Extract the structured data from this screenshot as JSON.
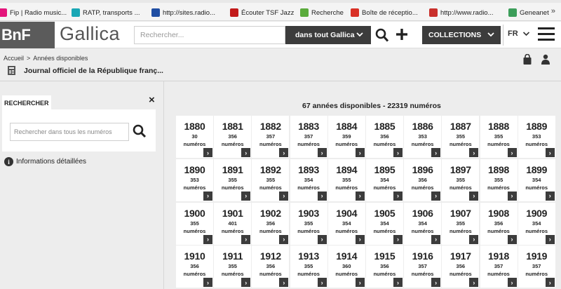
{
  "bookmarks": [
    {
      "label": "Fip | Radio music...",
      "icon": "fip-icon",
      "color": "#e4157c"
    },
    {
      "label": "RATP, transports ...",
      "icon": "ratp-icon",
      "color": "#1aa7b5"
    },
    {
      "label": "http://sites.radio...",
      "icon": "radiofrance-icon",
      "color": "#1f4ea3"
    },
    {
      "label": "Écouter TSF Jazz",
      "icon": "tsf-icon",
      "color": "#c21a1a"
    },
    {
      "label": "Recherche",
      "icon": "recherche-icon",
      "color": "#5aab3c"
    },
    {
      "label": "Boîte de réceptio...",
      "icon": "gmail-icon",
      "color": "#d93025"
    },
    {
      "label": "http://www.radio...",
      "icon": "radio-icon",
      "color": "#c9302c"
    },
    {
      "label": "Geneanet",
      "icon": "geneanet-icon",
      "color": "#3c9e5a"
    }
  ],
  "bookmarks_more": "»",
  "header": {
    "logo_bnf": "BnF",
    "logo_gallica": "Gallica",
    "search_placeholder": "Rechercher...",
    "scope": "dans tout Gallica",
    "collections": "COLLECTIONS",
    "lang": "FR"
  },
  "breadcrumb": {
    "home": "Accueil",
    "sep": ">",
    "current": "Années disponibles"
  },
  "doc_title": "Journal officiel de la République franç...",
  "left": {
    "tab": "RECHERCHER",
    "close": "×",
    "search_placeholder": "Rechercher dans tous les numéros",
    "info": "Informations détaillées"
  },
  "summary": "67 années disponibles - 22319 numéros",
  "unit_label": "numéros",
  "go_label": "›",
  "years": [
    {
      "year": "1880",
      "count": "30"
    },
    {
      "year": "1881",
      "count": "356"
    },
    {
      "year": "1882",
      "count": "357"
    },
    {
      "year": "1883",
      "count": "357"
    },
    {
      "year": "1884",
      "count": "359"
    },
    {
      "year": "1885",
      "count": "356"
    },
    {
      "year": "1886",
      "count": "353"
    },
    {
      "year": "1887",
      "count": "355"
    },
    {
      "year": "1888",
      "count": "355"
    },
    {
      "year": "1889",
      "count": "353"
    },
    {
      "year": "1890",
      "count": "353"
    },
    {
      "year": "1891",
      "count": "355"
    },
    {
      "year": "1892",
      "count": "355"
    },
    {
      "year": "1893",
      "count": "354"
    },
    {
      "year": "1894",
      "count": "355"
    },
    {
      "year": "1895",
      "count": "354"
    },
    {
      "year": "1896",
      "count": "356"
    },
    {
      "year": "1897",
      "count": "355"
    },
    {
      "year": "1898",
      "count": "355"
    },
    {
      "year": "1899",
      "count": "354"
    },
    {
      "year": "1900",
      "count": "355"
    },
    {
      "year": "1901",
      "count": "401"
    },
    {
      "year": "1902",
      "count": "356"
    },
    {
      "year": "1903",
      "count": "355"
    },
    {
      "year": "1904",
      "count": "354"
    },
    {
      "year": "1905",
      "count": "354"
    },
    {
      "year": "1906",
      "count": "354"
    },
    {
      "year": "1907",
      "count": "355"
    },
    {
      "year": "1908",
      "count": "356"
    },
    {
      "year": "1909",
      "count": "354"
    },
    {
      "year": "1910",
      "count": "356"
    },
    {
      "year": "1911",
      "count": "355"
    },
    {
      "year": "1912",
      "count": "356"
    },
    {
      "year": "1913",
      "count": "355"
    },
    {
      "year": "1914",
      "count": "360"
    },
    {
      "year": "1915",
      "count": "356"
    },
    {
      "year": "1916",
      "count": "357"
    },
    {
      "year": "1917",
      "count": "356"
    },
    {
      "year": "1918",
      "count": "357"
    },
    {
      "year": "1919",
      "count": "357"
    }
  ]
}
